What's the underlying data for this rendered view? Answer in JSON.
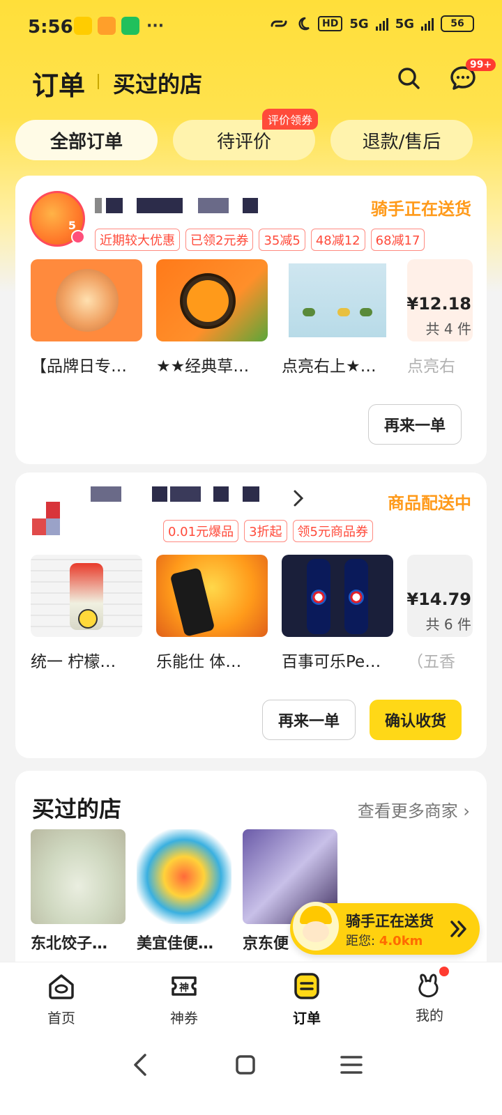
{
  "status_bar": {
    "time": "5:56",
    "hd": "HD",
    "net1": "5G",
    "net2": "5G",
    "battery": "56"
  },
  "header": {
    "title": "订单",
    "subtitle": "买过的店",
    "msg_badge": "99+"
  },
  "tabs": {
    "all": "全部订单",
    "review": "待评价",
    "review_badge": "评价领券",
    "refund": "退款/售后"
  },
  "orders": [
    {
      "status": "骑手正在送货",
      "promos": [
        "近期较大优惠",
        "已领2元券",
        "35减5",
        "48减12",
        "68减17"
      ],
      "logo_badge": "5",
      "products": [
        "【品牌日专…",
        "★★经典草…",
        "点亮右上★…",
        "点亮右"
      ],
      "price": "¥12.18",
      "count": "共 4 件",
      "reorder": "再来一单"
    },
    {
      "status": "商品配送中",
      "promos": [
        "0.01元爆品",
        "3折起",
        "领5元商品券"
      ],
      "products": [
        "统一 柠檬…",
        "乐能仕 体…",
        "百事可乐Pe…",
        "（五香"
      ],
      "price": "¥14.79",
      "count": "共 6 件",
      "reorder": "再来一单",
      "confirm": "确认收货"
    }
  ],
  "bought": {
    "title": "买过的店",
    "more": "查看更多商家",
    "stores": [
      "东北饺子…",
      "美宜佳便…",
      "京东便"
    ]
  },
  "rider": {
    "title": "骑手正在送货",
    "dist_label": "距您:",
    "dist_value": "4.0km"
  },
  "bottom_nav": {
    "home": "首页",
    "coupon": "神券",
    "orders": "订单",
    "mine": "我的"
  },
  "icons": {
    "search": "search-icon",
    "message": "message-icon",
    "chevron": "chevron-right-icon"
  },
  "colors": {
    "brand_yellow": "#ffd817",
    "status_orange": "#ff9a1a",
    "promo_red": "#ff4a3a"
  }
}
